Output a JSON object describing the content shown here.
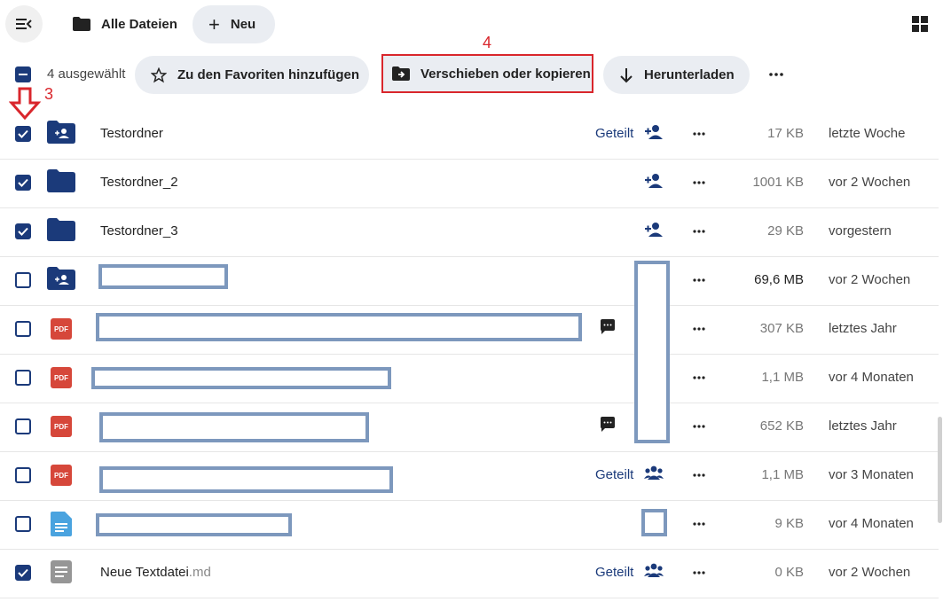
{
  "header": {
    "breadcrumb": "Alle Dateien",
    "new_button": "Neu"
  },
  "actions": {
    "selected_count": "4 ausgewählt",
    "favorite": "Zu den Favoriten hinzufügen",
    "move_copy": "Verschieben oder kopieren",
    "download": "Herunterladen"
  },
  "annotations": {
    "step3": "3",
    "step4": "4"
  },
  "colors": {
    "accent": "#1b3a7a",
    "annotation": "#d9262c",
    "pdf": "#d6473a",
    "redaction": "#7d98bd"
  },
  "rows": [
    {
      "name": "Testordner",
      "ext": "",
      "icon": "folder-shared-icon",
      "checked": true,
      "shared": "Geteilt",
      "share_icon": "person-add-icon",
      "size": "17 KB",
      "modified": "letzte Woche"
    },
    {
      "name": "Testordner_2",
      "ext": "",
      "icon": "folder-icon",
      "checked": true,
      "shared": "",
      "share_icon": "person-add-icon",
      "size": "1001 KB",
      "modified": "vor 2 Wochen"
    },
    {
      "name": "Testordner_3",
      "ext": "",
      "icon": "folder-icon",
      "checked": true,
      "shared": "",
      "share_icon": "person-add-icon",
      "size": "29 KB",
      "modified": "vorgestern"
    },
    {
      "name": "",
      "ext": "",
      "icon": "folder-shared-icon",
      "checked": false,
      "shared": "",
      "share_icon": "",
      "size": "69,6 MB",
      "modified": "vor 2 Wochen"
    },
    {
      "name": "",
      "ext": "",
      "icon": "pdf-icon",
      "checked": false,
      "shared": "",
      "share_icon": "",
      "size": "307 KB",
      "modified": "letztes Jahr"
    },
    {
      "name": "",
      "ext": "",
      "icon": "pdf-icon",
      "checked": false,
      "shared": "",
      "share_icon": "",
      "size": "1,1 MB",
      "modified": "vor 4 Monaten"
    },
    {
      "name": "",
      "ext": "",
      "icon": "pdf-icon",
      "checked": false,
      "shared": "",
      "share_icon": "",
      "size": "652 KB",
      "modified": "letztes Jahr"
    },
    {
      "name": "",
      "ext": "",
      "icon": "pdf-icon",
      "checked": false,
      "shared": "Geteilt",
      "share_icon": "group-icon",
      "size": "1,1 MB",
      "modified": "vor 3 Monaten"
    },
    {
      "name": "",
      "ext": "",
      "icon": "document-icon",
      "checked": false,
      "shared": "",
      "share_icon": "",
      "size": "9 KB",
      "modified": "vor 4 Monaten"
    },
    {
      "name": "Neue Textdatei",
      "ext": ".md",
      "icon": "text-file-icon",
      "checked": true,
      "shared": "Geteilt",
      "share_icon": "group-icon",
      "size": "0 KB",
      "modified": "vor 2 Wochen"
    }
  ],
  "pdf_label": "PDF"
}
